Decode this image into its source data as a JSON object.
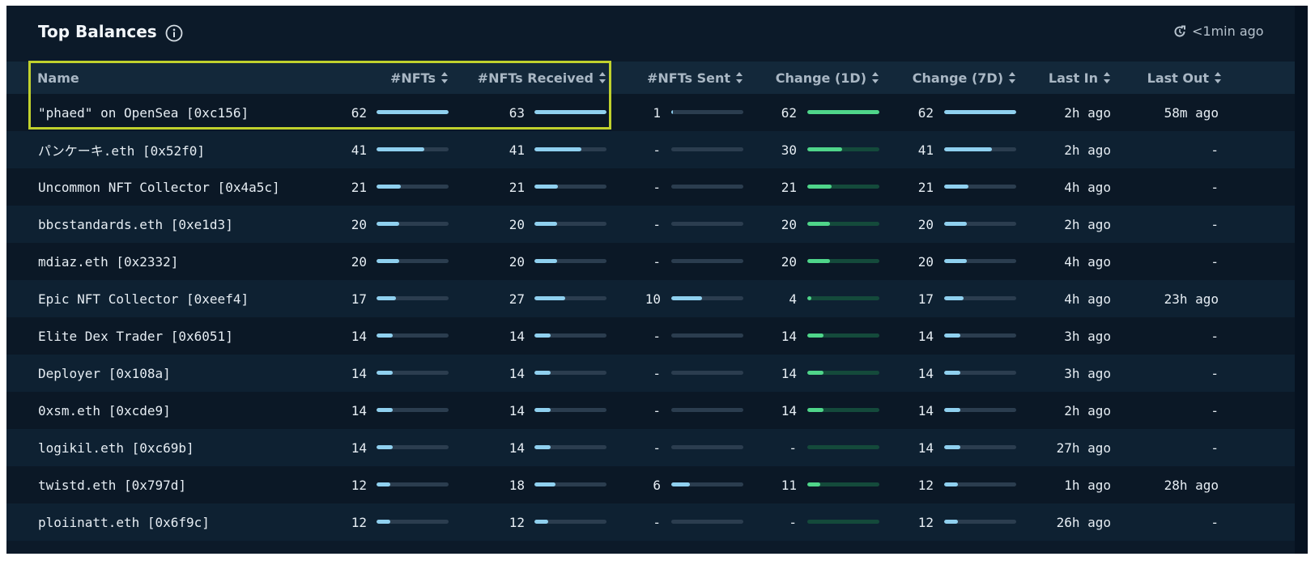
{
  "header": {
    "title": "Top Balances",
    "refresh_text": "<1min ago"
  },
  "columns": [
    "Name",
    "#NFTs",
    "#NFTs Received",
    "#NFTs Sent",
    "Change (1D)",
    "Change (7D)",
    "Last In",
    "Last Out"
  ],
  "colors": {
    "bar_blue": "#8fd0ef",
    "bar_green": "#4fd58a",
    "highlight": "#c0d12d"
  },
  "rows": [
    {
      "name": "\"phaed\" on OpenSea [0xc156]",
      "nfts": "62",
      "received": "63",
      "sent": "1",
      "change1d": "62",
      "change7d": "62",
      "last_in": "2h ago",
      "last_out": "58m ago",
      "fills": {
        "nfts": 1.0,
        "received": 1.0,
        "sent": 0.02,
        "change1d": 1.0,
        "change7d": 1.0
      }
    },
    {
      "name": "パンケーキ.eth [0x52f0]",
      "nfts": "41",
      "received": "41",
      "sent": "-",
      "change1d": "30",
      "change7d": "41",
      "last_in": "2h ago",
      "last_out": "-",
      "fills": {
        "nfts": 0.66,
        "received": 0.65,
        "sent": 0,
        "change1d": 0.48,
        "change7d": 0.66
      }
    },
    {
      "name": "Uncommon NFT Collector [0x4a5c]",
      "nfts": "21",
      "received": "21",
      "sent": "-",
      "change1d": "21",
      "change7d": "21",
      "last_in": "4h ago",
      "last_out": "-",
      "fills": {
        "nfts": 0.34,
        "received": 0.33,
        "sent": 0,
        "change1d": 0.34,
        "change7d": 0.34
      }
    },
    {
      "name": "bbcstandards.eth [0xe1d3]",
      "nfts": "20",
      "received": "20",
      "sent": "-",
      "change1d": "20",
      "change7d": "20",
      "last_in": "2h ago",
      "last_out": "-",
      "fills": {
        "nfts": 0.32,
        "received": 0.32,
        "sent": 0,
        "change1d": 0.32,
        "change7d": 0.32
      }
    },
    {
      "name": "mdiaz.eth [0x2332]",
      "nfts": "20",
      "received": "20",
      "sent": "-",
      "change1d": "20",
      "change7d": "20",
      "last_in": "4h ago",
      "last_out": "-",
      "fills": {
        "nfts": 0.32,
        "received": 0.32,
        "sent": 0,
        "change1d": 0.32,
        "change7d": 0.32
      }
    },
    {
      "name": "Epic NFT Collector [0xeef4]",
      "nfts": "17",
      "received": "27",
      "sent": "10",
      "change1d": "4",
      "change7d": "17",
      "last_in": "4h ago",
      "last_out": "23h ago",
      "fills": {
        "nfts": 0.27,
        "received": 0.43,
        "sent": 0.43,
        "change1d": 0.06,
        "change7d": 0.27
      }
    },
    {
      "name": "Elite Dex Trader [0x6051]",
      "nfts": "14",
      "received": "14",
      "sent": "-",
      "change1d": "14",
      "change7d": "14",
      "last_in": "3h ago",
      "last_out": "-",
      "fills": {
        "nfts": 0.23,
        "received": 0.22,
        "sent": 0,
        "change1d": 0.23,
        "change7d": 0.23
      }
    },
    {
      "name": "Deployer [0x108a]",
      "nfts": "14",
      "received": "14",
      "sent": "-",
      "change1d": "14",
      "change7d": "14",
      "last_in": "3h ago",
      "last_out": "-",
      "fills": {
        "nfts": 0.23,
        "received": 0.22,
        "sent": 0,
        "change1d": 0.23,
        "change7d": 0.23
      }
    },
    {
      "name": "0xsm.eth [0xcde9]",
      "nfts": "14",
      "received": "14",
      "sent": "-",
      "change1d": "14",
      "change7d": "14",
      "last_in": "2h ago",
      "last_out": "-",
      "fills": {
        "nfts": 0.23,
        "received": 0.22,
        "sent": 0,
        "change1d": 0.23,
        "change7d": 0.23
      }
    },
    {
      "name": "logikil.eth [0xc69b]",
      "nfts": "14",
      "received": "14",
      "sent": "-",
      "change1d": "-",
      "change7d": "14",
      "last_in": "27h ago",
      "last_out": "-",
      "fills": {
        "nfts": 0.23,
        "received": 0.22,
        "sent": 0,
        "change1d": 0,
        "change7d": 0.23
      }
    },
    {
      "name": "twistd.eth [0x797d]",
      "nfts": "12",
      "received": "18",
      "sent": "6",
      "change1d": "11",
      "change7d": "12",
      "last_in": "1h ago",
      "last_out": "28h ago",
      "fills": {
        "nfts": 0.19,
        "received": 0.29,
        "sent": 0.26,
        "change1d": 0.18,
        "change7d": 0.19
      }
    },
    {
      "name": "ploiinatt.eth [0x6f9c]",
      "nfts": "12",
      "received": "12",
      "sent": "-",
      "change1d": "-",
      "change7d": "12",
      "last_in": "26h ago",
      "last_out": "-",
      "fills": {
        "nfts": 0.19,
        "received": 0.19,
        "sent": 0,
        "change1d": 0,
        "change7d": 0.19
      }
    }
  ]
}
